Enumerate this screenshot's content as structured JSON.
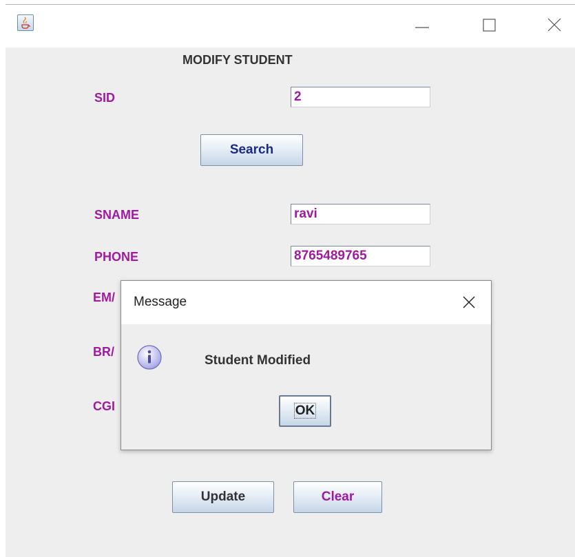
{
  "window": {
    "icon": "java-coffee-icon",
    "controls": [
      "minimize-icon",
      "maximize-icon",
      "close-icon"
    ]
  },
  "form": {
    "heading": "MODIFY STUDENT",
    "sid_label": "SID",
    "sid_value": "2",
    "search_label": "Search",
    "sname_label": "SNAME",
    "sname_value": "ravi",
    "phone_label": "PHONE",
    "phone_value": "8765489765",
    "email_label_visible": "EM/",
    "branch_label_visible": "BR/",
    "cgpa_label_visible": "CGI",
    "update_label": "Update",
    "clear_label": "Clear"
  },
  "dialog": {
    "title": "Message",
    "message": "Student Modified",
    "ok_label": "OK",
    "icon": "info-icon"
  },
  "colors": {
    "label": "#a01aa0",
    "search_text": "#1a2b8a",
    "background": "#eeeeee"
  }
}
